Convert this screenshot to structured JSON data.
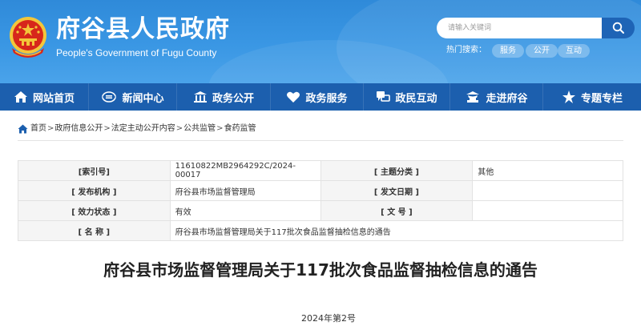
{
  "header": {
    "title": "府谷县人民政府",
    "subtitle": "People's Government of Fugu County",
    "search_placeholder": "请输入关键词",
    "hot_search_label": "热门搜索：",
    "hot_tags": [
      "服务",
      "公开",
      "互动"
    ]
  },
  "nav": {
    "items": [
      {
        "label": "网站首页",
        "icon": "home-icon"
      },
      {
        "label": "新闻中心",
        "icon": "news-icon"
      },
      {
        "label": "政务公开",
        "icon": "building-icon"
      },
      {
        "label": "政务服务",
        "icon": "heart-hands-icon"
      },
      {
        "label": "政民互动",
        "icon": "chat-icon"
      },
      {
        "label": "走进府谷",
        "icon": "landmark-icon"
      },
      {
        "label": "专题专栏",
        "icon": "star-icon"
      }
    ]
  },
  "breadcrumb": {
    "items": [
      "首页",
      "政府信息公开",
      "法定主动公开内容",
      "公共监管",
      "食药监管"
    ]
  },
  "info": {
    "index_label": "[索引号]",
    "index_value": "11610822MB2964292C/2024-00017",
    "topic_label": "[ 主题分类 ]",
    "topic_value": "其他",
    "issuer_label": "[ 发布机构 ]",
    "issuer_value": "府谷县市场监督管理局",
    "date_label": "[ 发文日期 ]",
    "date_value": "",
    "status_label": "[ 效力状态 ]",
    "status_value": "有效",
    "docno_label": "[ 文 号 ]",
    "docno_value": "",
    "name_label": "[ 名 称 ]",
    "name_value": "府谷县市场监督管理局关于117批次食品监督抽检信息的通告"
  },
  "article": {
    "title": "府谷县市场监督管理局关于117批次食品监督抽检信息的通告",
    "doc_number": "2024年第2号"
  },
  "colors": {
    "header_blue": "#3a97e4",
    "nav_blue": "#1c5fae",
    "search_button": "#1e64b6",
    "emblem_red": "#d7261b",
    "emblem_gold": "#f3c63a"
  }
}
